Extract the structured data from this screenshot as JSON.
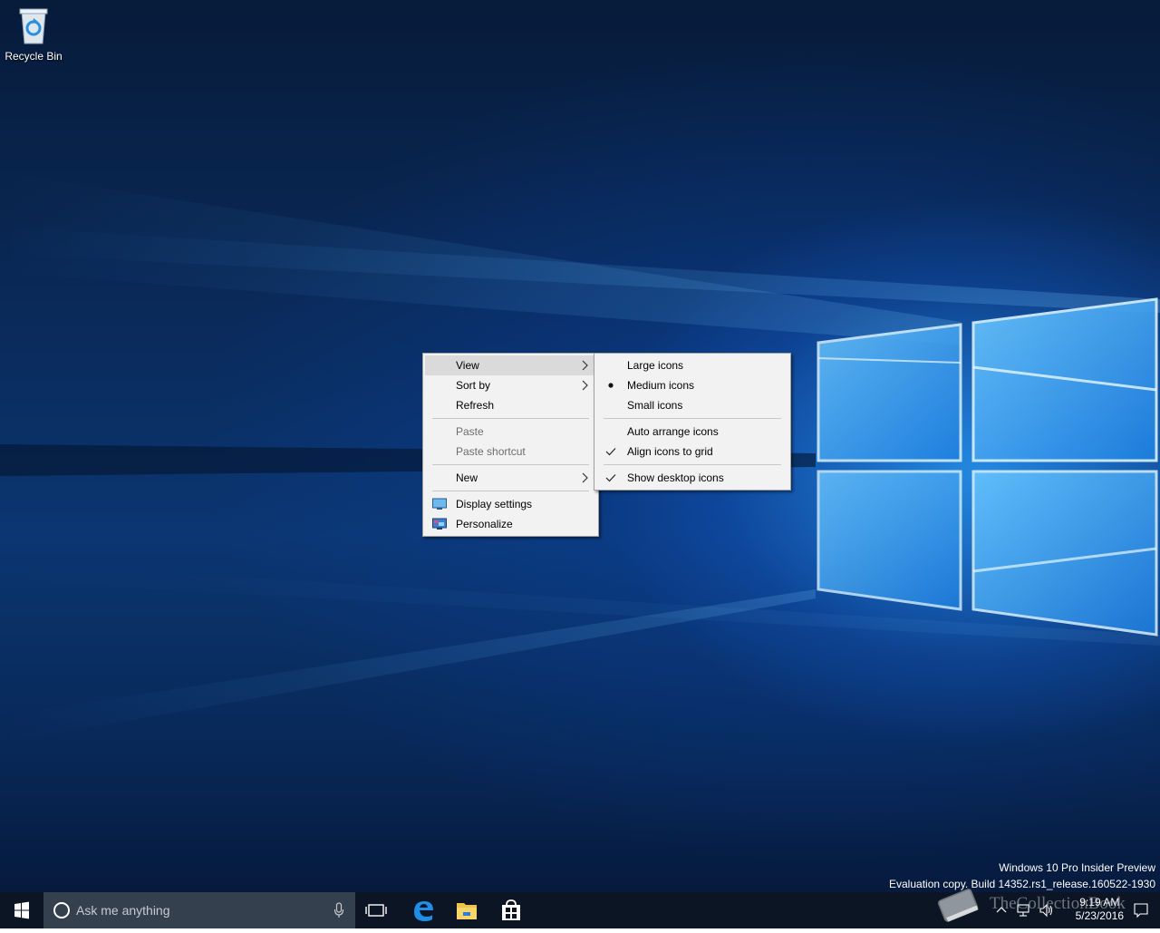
{
  "desktop": {
    "icons": [
      {
        "label": "Recycle Bin",
        "icon": "recycle-bin-icon"
      }
    ]
  },
  "context_menu": {
    "items": [
      {
        "label": "View",
        "submenu": true,
        "highlighted": true
      },
      {
        "label": "Sort by",
        "submenu": true
      },
      {
        "label": "Refresh"
      },
      {
        "label": "Paste",
        "disabled": true
      },
      {
        "label": "Paste shortcut",
        "disabled": true
      },
      {
        "label": "New",
        "submenu": true
      },
      {
        "label": "Display settings",
        "icon": "display-settings-icon"
      },
      {
        "label": "Personalize",
        "icon": "personalize-icon"
      }
    ]
  },
  "view_submenu": {
    "items": [
      {
        "label": "Large icons"
      },
      {
        "label": "Medium icons",
        "selected": true,
        "mark": "bullet"
      },
      {
        "label": "Small icons"
      },
      {
        "label": "Auto arrange icons"
      },
      {
        "label": "Align icons to grid",
        "checked": true,
        "mark": "check"
      },
      {
        "label": "Show desktop icons",
        "checked": true,
        "mark": "check"
      }
    ]
  },
  "watermark": {
    "line1": "Windows 10 Pro Insider Preview",
    "line2": "Evaluation copy. Build 14352.rs1_release.160522-1930"
  },
  "taskbar": {
    "search_placeholder": "Ask me anything",
    "pinned": [
      "task-view-icon",
      "edge-icon",
      "file-explorer-icon",
      "store-icon"
    ],
    "clock_time": "9:19 AM",
    "clock_date": "5/23/2016"
  },
  "overlay_watermark": {
    "text": "TheCollectionBook"
  },
  "colors": {
    "taskbar": "#0c1523",
    "search_box": "#35404e",
    "menu_bg": "#f2f2f2",
    "menu_highlight": "#dadada",
    "accent": "#1e7ad6"
  }
}
